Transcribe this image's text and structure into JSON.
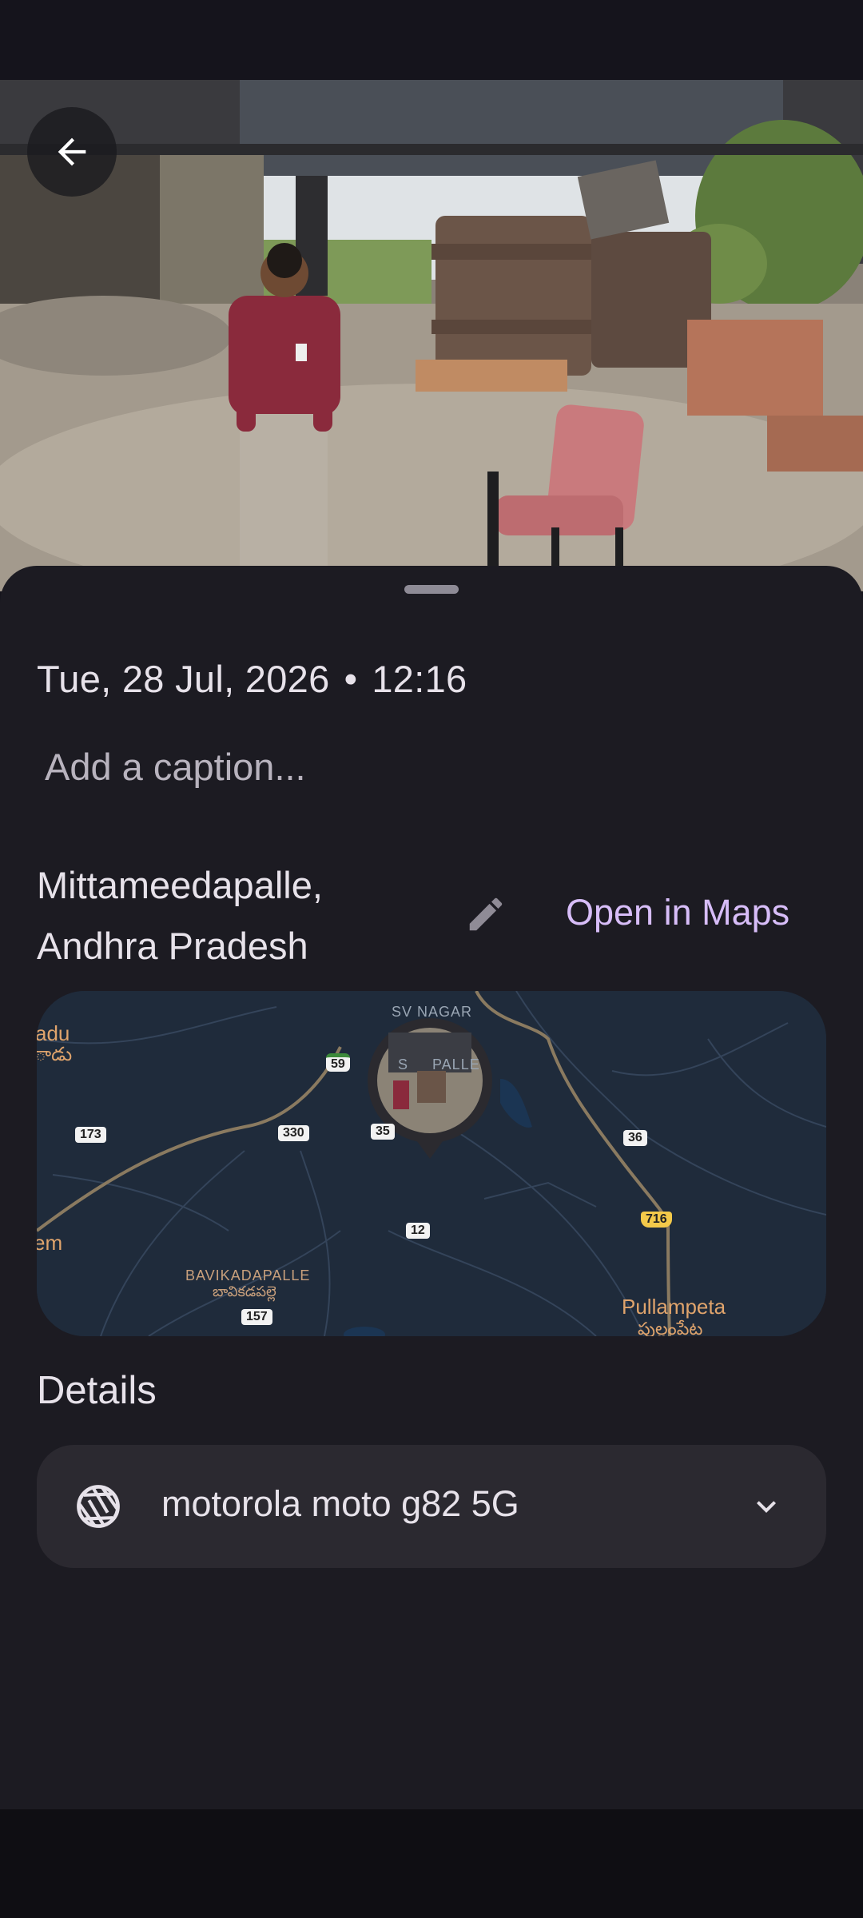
{
  "photo": {
    "description_icon": "photo"
  },
  "back_button": {
    "icon": "arrow-back-icon"
  },
  "info": {
    "date": "Tue, 28 Jul, 2026",
    "separator": "•",
    "time": "12:16",
    "caption_placeholder": "Add a caption...",
    "location_line1": "Mittameedapalle,",
    "location_line2": "Andhra Pradesh",
    "open_in_maps": "Open in Maps"
  },
  "map": {
    "labels": {
      "sv_nagar": "SV NAGAR",
      "palle": "S     PALLE",
      "adu": "adu",
      "telugu_left": "ాడు",
      "em": "em",
      "bavikadapalle": "BAVIKADAPALLE",
      "bavikadapalle_te": "బావికడపల్లె",
      "pullampeta": "Pullampeta",
      "pullampeta_te": "పుల్లంపేట"
    },
    "road_shields": {
      "r59": "59",
      "r173": "173",
      "r330": "330",
      "r35": "35",
      "r36": "36",
      "r716": "716",
      "r12": "12",
      "r157": "157"
    }
  },
  "details": {
    "title": "Details",
    "device": "motorola moto g82 5G"
  },
  "colors": {
    "background": "#15141c",
    "sheet": "#1c1b22",
    "accent": "#d7bdf8",
    "card": "#2b2930",
    "map_bg": "#1f2a3a"
  }
}
